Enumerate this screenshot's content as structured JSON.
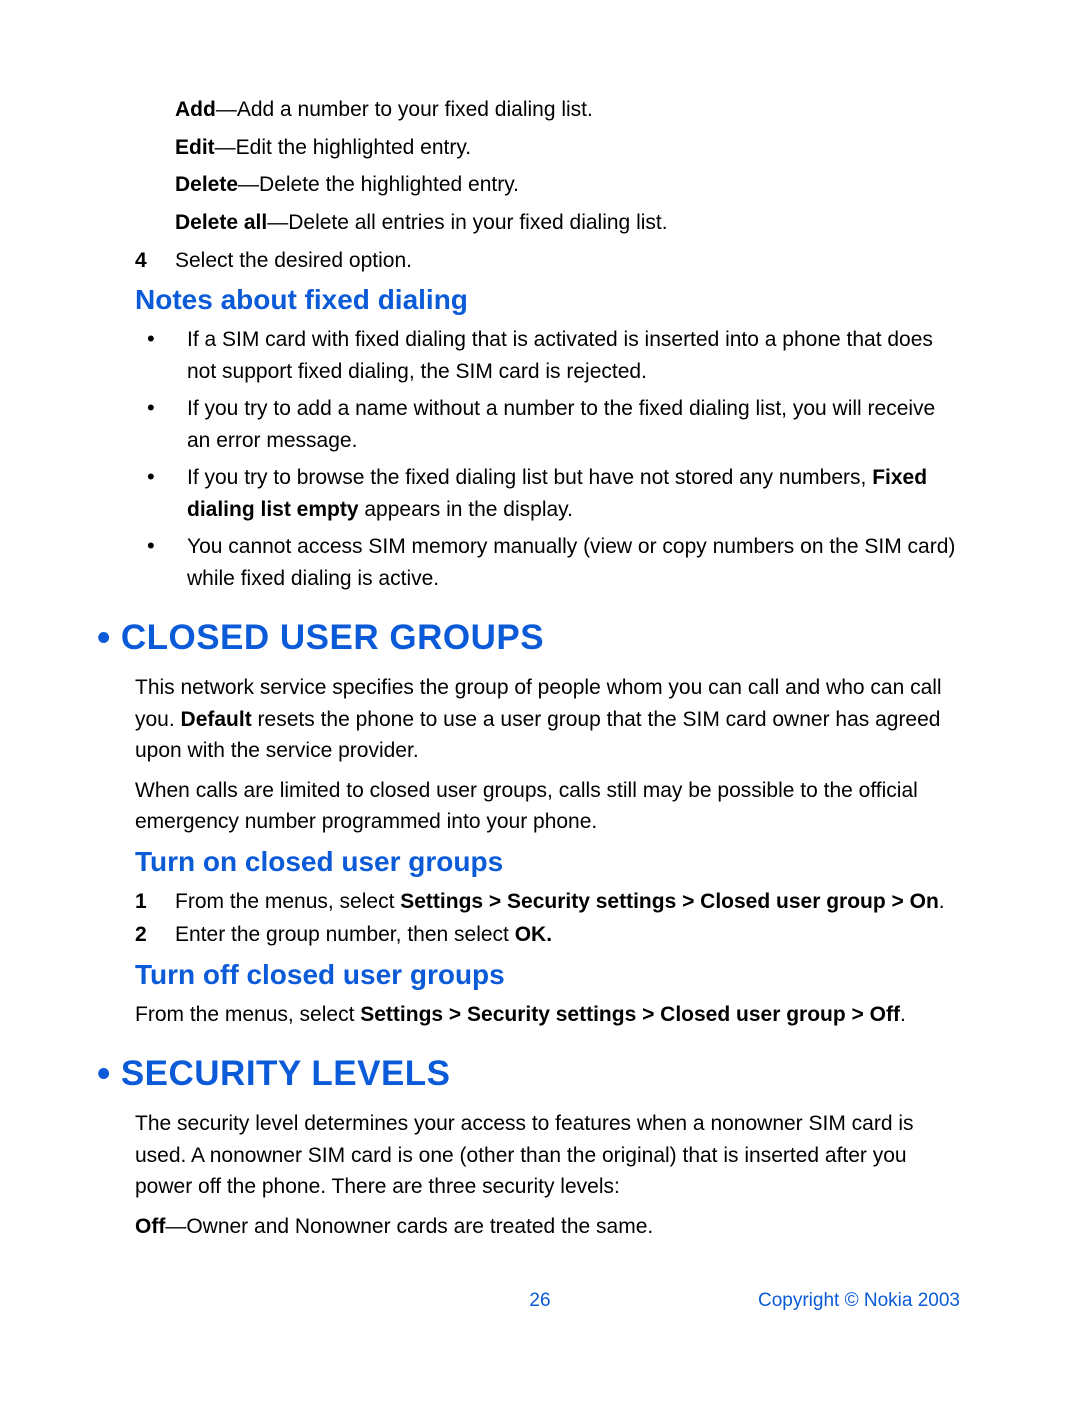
{
  "definitions": [
    {
      "term": "Add",
      "desc": "—Add a number to your fixed dialing list."
    },
    {
      "term": "Edit",
      "desc": "—Edit the highlighted entry."
    },
    {
      "term": "Delete",
      "desc": "—Delete the highlighted entry."
    },
    {
      "term": "Delete all",
      "desc": "—Delete all entries in your fixed dialing list."
    }
  ],
  "step4": {
    "num": "4",
    "text": "Select the desired option."
  },
  "notes_heading": "Notes about fixed dialing",
  "notes": [
    {
      "pre": "If a SIM card with fixed dialing that is activated is inserted into a phone that does not support fixed dialing, the SIM card is rejected.",
      "bold": "",
      "post": ""
    },
    {
      "pre": "If you try to add a name without a number to the fixed dialing list, you will receive an error message.",
      "bold": "",
      "post": ""
    },
    {
      "pre": "If you try to browse the fixed dialing list but have not stored any numbers, ",
      "bold": "Fixed dialing list empty",
      "post": " appears in the display."
    },
    {
      "pre": "You cannot access SIM memory manually (view or copy numbers on the SIM card) while fixed dialing is active.",
      "bold": "",
      "post": ""
    }
  ],
  "cug": {
    "heading": "CLOSED USER GROUPS",
    "p1_pre": "This network service specifies the group of people whom you can call and who can call you. ",
    "p1_bold": "Default",
    "p1_post": " resets the phone to use a user group that the SIM card owner has agreed upon with the service provider.",
    "p2": "When calls are limited to closed user groups, calls still may be possible to the official emergency number programmed into your phone.",
    "turn_on_h": "Turn on closed user groups",
    "turn_on_steps": [
      {
        "n": "1",
        "pre": "From the menus, select ",
        "bold": "Settings > Security settings > Closed user group > On",
        "post": "."
      },
      {
        "n": "2",
        "pre": "Enter the group number, then select ",
        "bold": "OK.",
        "post": ""
      }
    ],
    "turn_off_h": "Turn off closed user groups",
    "turn_off_pre": "From the menus, select ",
    "turn_off_bold": "Settings > Security settings > Closed user group > Off",
    "turn_off_post": "."
  },
  "security": {
    "heading": "SECURITY LEVELS",
    "p1": "The security level determines your access to features when a nonowner SIM card is used. A nonowner SIM card is one (other than the original) that is inserted after you power off the phone. There are three security levels:",
    "off_term": "Off",
    "off_desc": "—Owner and Nonowner cards are treated the same."
  },
  "footer": {
    "page_number": "26",
    "copyright": "Copyright © Nokia 2003"
  }
}
